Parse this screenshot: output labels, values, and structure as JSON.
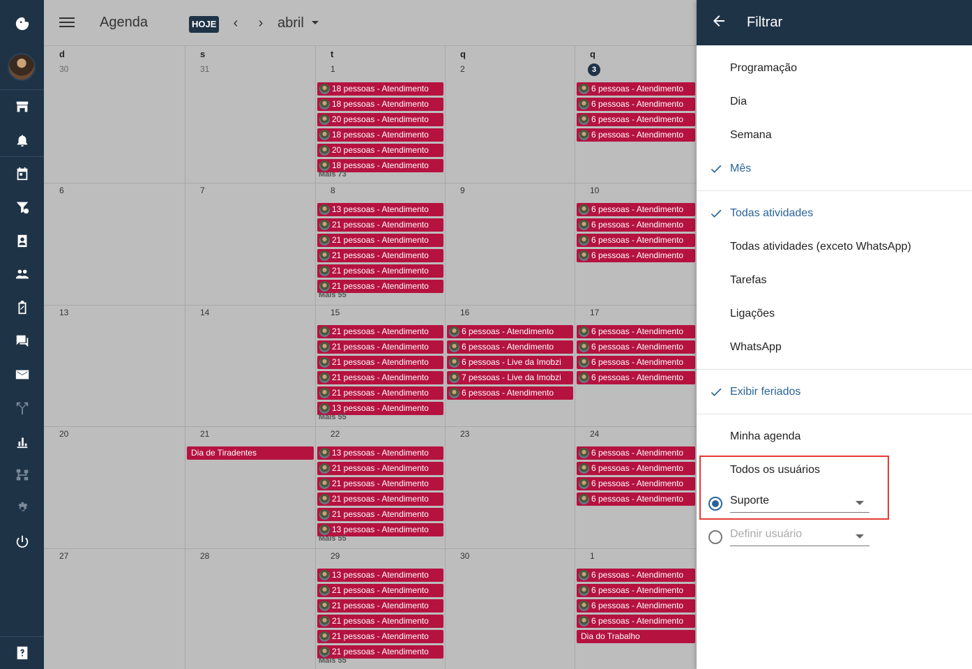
{
  "topbar": {
    "title": "Agenda",
    "today_label": "HOJE",
    "prev_icon": "chevron-left-icon",
    "next_icon": "chevron-right-icon",
    "month": "abril"
  },
  "weekdays": [
    "d",
    "s",
    "t",
    "q",
    "q"
  ],
  "weeks": [
    {
      "days": [
        {
          "num": "30",
          "muted": true
        },
        {
          "num": "31",
          "muted": true
        },
        {
          "num": "1",
          "events": [
            "18 pessoas - Atendimento",
            "18 pessoas - Atendimento",
            "20 pessoas - Atendimento",
            "18 pessoas - Atendimento",
            "20 pessoas - Atendimento",
            "18 pessoas - Atendimento"
          ],
          "more": "Mais 73"
        },
        {
          "num": "2"
        },
        {
          "num": "3",
          "today": true,
          "events": [
            "6 pessoas - Atendimento",
            "6 pessoas - Atendimento",
            "6 pessoas - Atendimento",
            "6 pessoas - Atendimento"
          ]
        }
      ]
    },
    {
      "days": [
        {
          "num": "6"
        },
        {
          "num": "7"
        },
        {
          "num": "8",
          "events": [
            "13 pessoas - Atendimento",
            "21 pessoas - Atendimento",
            "21 pessoas - Atendimento",
            "21 pessoas - Atendimento",
            "21 pessoas - Atendimento",
            "21 pessoas - Atendimento"
          ],
          "more": "Mais 55"
        },
        {
          "num": "9"
        },
        {
          "num": "10",
          "events": [
            "6 pessoas - Atendimento",
            "6 pessoas - Atendimento",
            "6 pessoas - Atendimento",
            "6 pessoas - Atendimento"
          ]
        }
      ]
    },
    {
      "days": [
        {
          "num": "13"
        },
        {
          "num": "14"
        },
        {
          "num": "15",
          "events": [
            "21 pessoas - Atendimento",
            "21 pessoas - Atendimento",
            "21 pessoas - Atendimento",
            "21 pessoas - Atendimento",
            "21 pessoas - Atendimento",
            "13 pessoas - Atendimento"
          ],
          "more": "Mais 55"
        },
        {
          "num": "16",
          "events": [
            "6 pessoas - Atendimento",
            "6 pessoas - Atendimento",
            "6 pessoas - Live da Imobzi",
            "7 pessoas - Live da Imobzi",
            "6 pessoas - Atendimento"
          ]
        },
        {
          "num": "17",
          "events": [
            "6 pessoas - Atendimento",
            "6 pessoas - Atendimento",
            "6 pessoas - Atendimento",
            "6 pessoas - Atendimento"
          ]
        }
      ]
    },
    {
      "days": [
        {
          "num": "20"
        },
        {
          "num": "21",
          "holiday": "Dia de Tiradentes"
        },
        {
          "num": "22",
          "events": [
            "13 pessoas - Atendimento",
            "21 pessoas - Atendimento",
            "21 pessoas - Atendimento",
            "21 pessoas - Atendimento",
            "21 pessoas - Atendimento",
            "13 pessoas - Atendimento"
          ],
          "more": "Mais 55"
        },
        {
          "num": "23"
        },
        {
          "num": "24",
          "events": [
            "6 pessoas - Atendimento",
            "6 pessoas - Atendimento",
            "6 pessoas - Atendimento",
            "6 pessoas - Atendimento"
          ]
        }
      ]
    },
    {
      "days": [
        {
          "num": "27"
        },
        {
          "num": "28"
        },
        {
          "num": "29",
          "events": [
            "13 pessoas - Atendimento",
            "21 pessoas - Atendimento",
            "21 pessoas - Atendimento",
            "21 pessoas - Atendimento",
            "21 pessoas - Atendimento",
            "21 pessoas - Atendimento"
          ],
          "more": "Mais 55"
        },
        {
          "num": "30"
        },
        {
          "num": "1",
          "events": [
            "6 pessoas - Atendimento",
            "6 pessoas - Atendimento",
            "6 pessoas - Atendimento",
            "6 pessoas - Atendimento"
          ],
          "holiday_after": "Dia do Trabalho"
        }
      ]
    }
  ],
  "rail": {
    "icons": [
      "logo-icon",
      "store-icon",
      "bell-icon",
      "calendar-icon",
      "funnel-icon",
      "contacts-icon",
      "people-icon",
      "clipboard-icon",
      "chat-icon",
      "mail-icon",
      "fork-icon",
      "bar-chart-icon",
      "sitemap-icon",
      "gear-icon",
      "power-icon",
      "help-icon"
    ]
  },
  "panel": {
    "title": "Filtrar",
    "view_options": [
      "Programação",
      "Dia",
      "Semana",
      "Mês"
    ],
    "view_selected": "Mês",
    "activity_options": [
      "Todas atividades",
      "Todas atividades (exceto WhatsApp)",
      "Tarefas",
      "Ligações",
      "WhatsApp"
    ],
    "activity_selected": "Todas atividades",
    "holidays_label": "Exibir feriados",
    "my_agenda": "Minha agenda",
    "all_users": "Todos os usuários",
    "user_select_value": "Suporte",
    "define_user_placeholder": "Definir usuário"
  },
  "colors": {
    "rail_bg": "#1f3347",
    "event_bg": "#b5123f",
    "accent": "#2a6496",
    "highlight": "#e53935"
  }
}
